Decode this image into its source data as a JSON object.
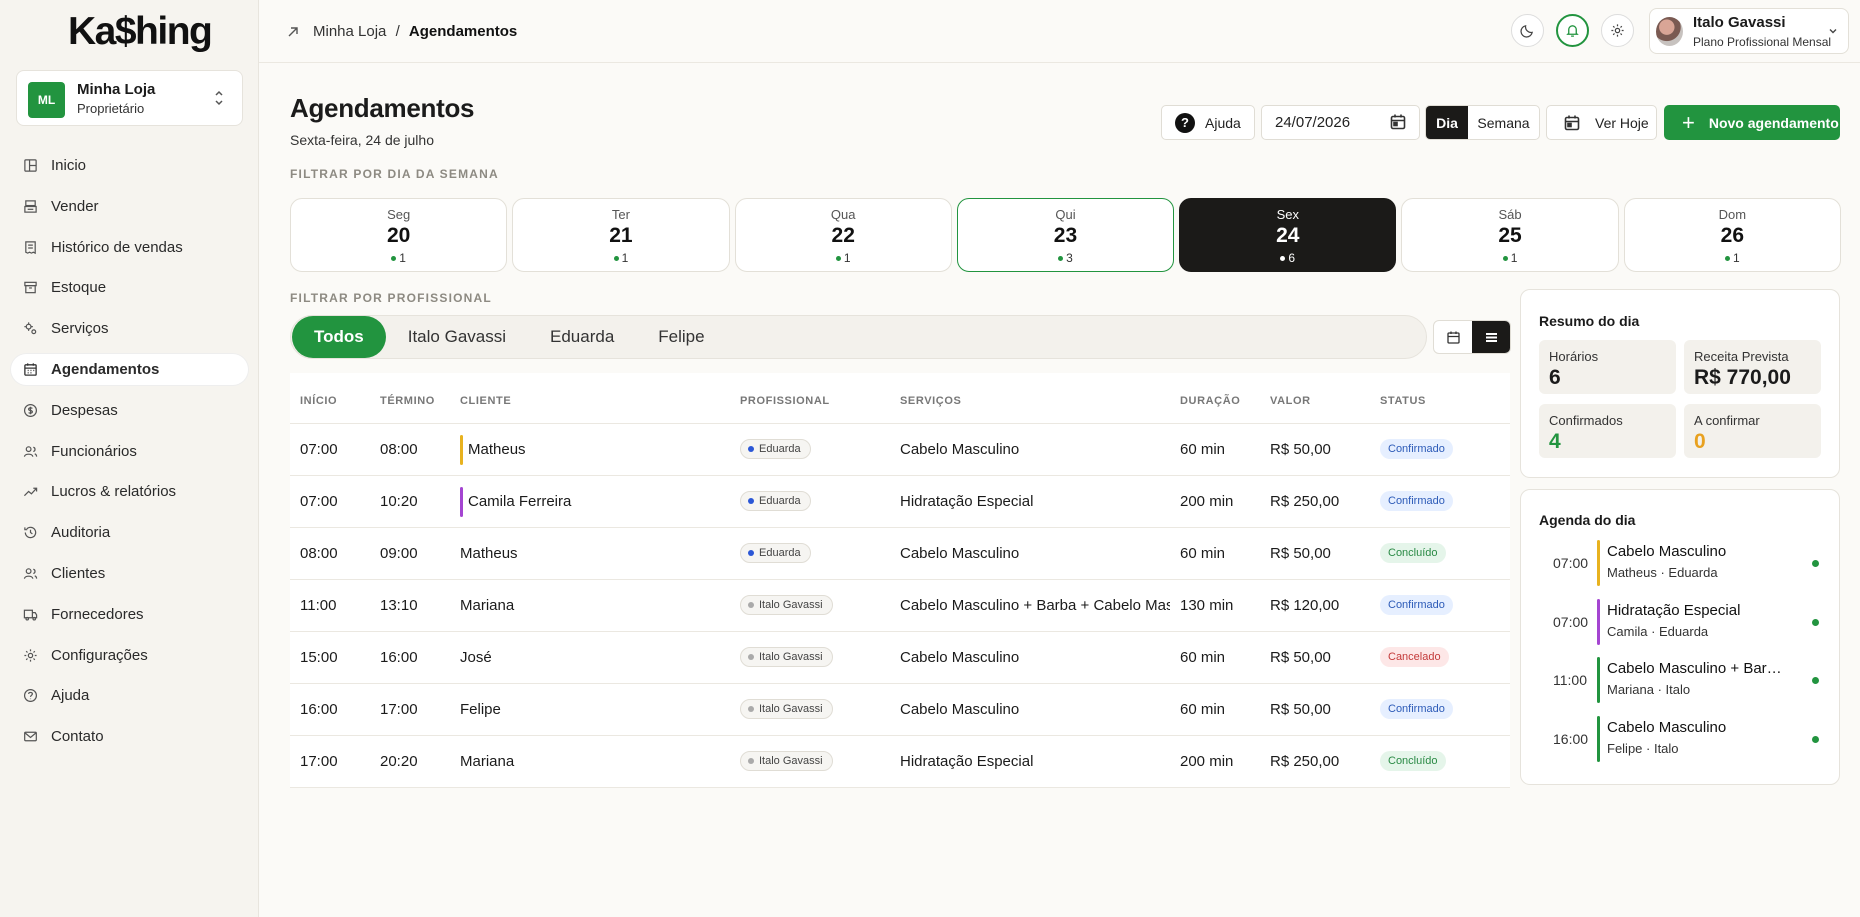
{
  "app": {
    "logo": "Ka$hing"
  },
  "store": {
    "initials": "ML",
    "name": "Minha Loja",
    "role": "Proprietário"
  },
  "sidebar": {
    "items": [
      {
        "label": "Inicio",
        "icon": "dashboard-icon"
      },
      {
        "label": "Vender",
        "icon": "register-icon"
      },
      {
        "label": "Histórico de vendas",
        "icon": "receipt-icon"
      },
      {
        "label": "Estoque",
        "icon": "archive-icon"
      },
      {
        "label": "Serviços",
        "icon": "cogs-icon"
      },
      {
        "label": "Agendamentos",
        "icon": "calendar-icon",
        "active": true
      },
      {
        "label": "Despesas",
        "icon": "dollar-icon"
      },
      {
        "label": "Funcionários",
        "icon": "users-icon"
      },
      {
        "label": "Lucros & relatórios",
        "icon": "trend-icon"
      },
      {
        "label": "Auditoria",
        "icon": "history-icon"
      },
      {
        "label": "Clientes",
        "icon": "clients-icon"
      },
      {
        "label": "Fornecedores",
        "icon": "truck-icon"
      },
      {
        "label": "Configurações",
        "icon": "gear-icon"
      },
      {
        "label": "Ajuda",
        "icon": "help-icon"
      },
      {
        "label": "Contato",
        "icon": "mail-icon"
      }
    ]
  },
  "topbar": {
    "breadcrumb_root": "Minha Loja",
    "breadcrumb_sep": "/",
    "breadcrumb_current": "Agendamentos",
    "user_name": "Italo Gavassi",
    "user_plan": "Plano Profissional Mensal"
  },
  "header": {
    "title": "Agendamentos",
    "subtitle": "Sexta-feira, 24 de julho",
    "help_label": "Ajuda",
    "date_value": "24/07/2026",
    "view_day": "Dia",
    "view_week": "Semana",
    "today_label": "Ver Hoje",
    "new_label": "Novo agendamento"
  },
  "filters": {
    "weekday_label": "FILTRAR POR DIA DA SEMANA",
    "professional_label": "FILTRAR POR PROFISSIONAL"
  },
  "days": [
    {
      "name": "Seg",
      "num": "20",
      "count": "1"
    },
    {
      "name": "Ter",
      "num": "21",
      "count": "1"
    },
    {
      "name": "Qua",
      "num": "22",
      "count": "1"
    },
    {
      "name": "Qui",
      "num": "23",
      "count": "3",
      "today": true
    },
    {
      "name": "Sex",
      "num": "24",
      "count": "6",
      "selected": true
    },
    {
      "name": "Sáb",
      "num": "25",
      "count": "1"
    },
    {
      "name": "Dom",
      "num": "26",
      "count": "1"
    }
  ],
  "professionals": [
    "Todos",
    "Italo Gavassi",
    "Eduarda",
    "Felipe"
  ],
  "table": {
    "columns": [
      "INÍCIO",
      "TÉRMINO",
      "CLIENTE",
      "PROFISSIONAL",
      "SERVIÇOS",
      "DURAÇÃO",
      "VALOR",
      "STATUS"
    ],
    "rows": [
      {
        "start": "07:00",
        "end": "08:00",
        "client": "Matheus",
        "bar": "#e8b21f",
        "pro": "Eduarda",
        "pro_color": "#2b57d6",
        "service": "Cabelo Masculino",
        "duration": "60 min",
        "value": "R$ 50,00",
        "status": "Confirmado"
      },
      {
        "start": "07:00",
        "end": "10:20",
        "client": "Camila Ferreira",
        "bar": "#a445d1",
        "pro": "Eduarda",
        "pro_color": "#2b57d6",
        "service": "Hidratação Especial",
        "duration": "200 min",
        "value": "R$ 250,00",
        "status": "Confirmado"
      },
      {
        "start": "08:00",
        "end": "09:00",
        "client": "Matheus",
        "bar": "",
        "pro": "Eduarda",
        "pro_color": "#2b57d6",
        "service": "Cabelo Masculino",
        "duration": "60 min",
        "value": "R$ 50,00",
        "status": "Concluído"
      },
      {
        "start": "11:00",
        "end": "13:10",
        "client": "Mariana",
        "bar": "",
        "pro": "Italo Gavassi",
        "pro_color": "#aaaaaa",
        "service": "Cabelo Masculino + Barba + Cabelo Masculino",
        "duration": "130 min",
        "value": "R$ 120,00",
        "status": "Confirmado"
      },
      {
        "start": "15:00",
        "end": "16:00",
        "client": "José",
        "bar": "",
        "pro": "Italo Gavassi",
        "pro_color": "#aaaaaa",
        "service": "Cabelo Masculino",
        "duration": "60 min",
        "value": "R$ 50,00",
        "status": "Cancelado"
      },
      {
        "start": "16:00",
        "end": "17:00",
        "client": "Felipe",
        "bar": "",
        "pro": "Italo Gavassi",
        "pro_color": "#aaaaaa",
        "service": "Cabelo Masculino",
        "duration": "60 min",
        "value": "R$ 50,00",
        "status": "Confirmado"
      },
      {
        "start": "17:00",
        "end": "20:20",
        "client": "Mariana",
        "bar": "",
        "pro": "Italo Gavassi",
        "pro_color": "#aaaaaa",
        "service": "Hidratação Especial",
        "duration": "200 min",
        "value": "R$ 250,00",
        "status": "Concluído"
      }
    ]
  },
  "summary": {
    "title": "Resumo do dia",
    "slots_label": "Horários",
    "slots": "6",
    "revenue_label": "Receita Prevista",
    "revenue": "R$ 770,00",
    "confirmed_label": "Confirmados",
    "confirmed": "4",
    "pending_label": "A confirmar",
    "pending": "0"
  },
  "agenda": {
    "title": "Agenda do dia",
    "items": [
      {
        "time": "07:00",
        "service": "Cabelo Masculino",
        "people": "Matheus · Eduarda",
        "color": "#e8b21f"
      },
      {
        "time": "07:00",
        "service": "Hidratação Especial",
        "people": "Camila · Eduarda",
        "color": "#a445d1"
      },
      {
        "time": "11:00",
        "service": "Cabelo Masculino + Barba ...",
        "people": "Mariana · Italo",
        "color": "#22943f"
      },
      {
        "time": "16:00",
        "service": "Cabelo Masculino",
        "people": "Felipe · Italo",
        "color": "#22943f"
      }
    ]
  }
}
